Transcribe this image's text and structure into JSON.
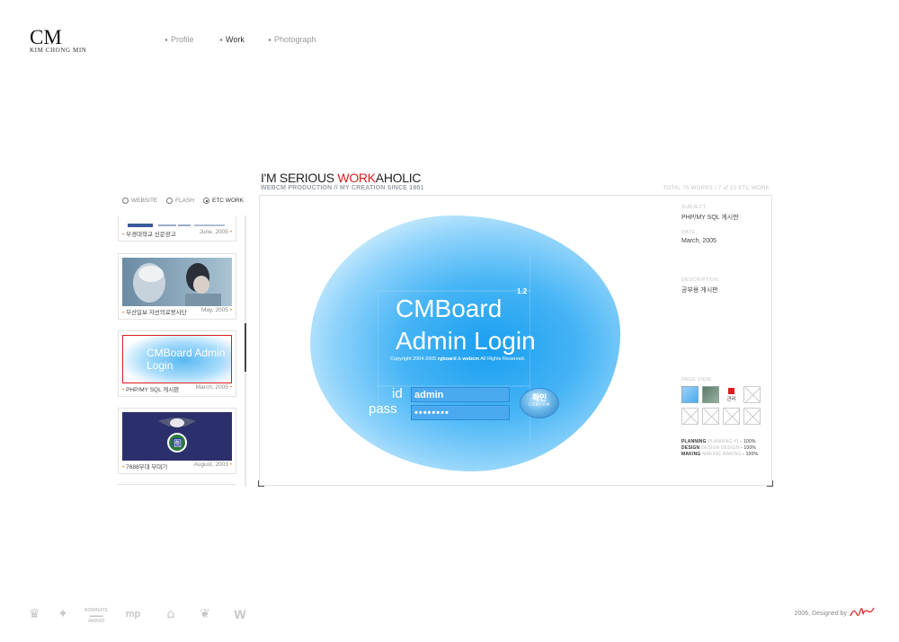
{
  "logo": {
    "mark": "CM",
    "name": "KIM CHONG MIN"
  },
  "nav": [
    {
      "label": "Profile",
      "active": false
    },
    {
      "label": "Work",
      "active": true
    },
    {
      "label": "Photograph",
      "active": false
    }
  ],
  "header": {
    "headline_prefix": "I'M SERIOUS ",
    "headline_highlight": "WORK",
    "headline_suffix": "AHOLIC",
    "subline": "WEBCM PRODUCTION // MY CREATION SINCE 1981",
    "total": "TOTAL 75 WORKS / 7 of 10 ETC WORK"
  },
  "filters": [
    {
      "label": "WEBSITE",
      "selected": false
    },
    {
      "label": "FLASH",
      "selected": false
    },
    {
      "label": "ETC WORK",
      "selected": true
    }
  ],
  "works": [
    {
      "title": "부경대학교 신문광고",
      "date": "June, 2005"
    },
    {
      "title": "부산일보 자선의료봉사단",
      "date": "May, 2005"
    },
    {
      "title": "PHP/MY SQL 게시판",
      "date": "March, 2005",
      "thumb_title": "CMBoard Admin Login"
    },
    {
      "title": "7688부대 부대기",
      "date": "August, 2003"
    }
  ],
  "preview": {
    "title_line1": "CMBoard",
    "title_line2": "Admin Login",
    "version": "1.2",
    "copyright_pre": "Copyright 2004-2005 ",
    "copyright_b1": "rgboard",
    "copyright_mid": " & ",
    "copyright_b2": "webcm",
    "copyright_post": " All Rights Reserved.",
    "id_label": "id",
    "pass_label": "pass",
    "id_value": "admin",
    "pass_value": "••••••••",
    "confirm_kr": "확인",
    "confirm_en": "CONFIRM"
  },
  "details": {
    "subject_label": "SUBJECT.",
    "subject": "PHP/MY SQL 게시판",
    "date_label": "DATE.",
    "date": "March, 2005",
    "description_label": "DESCRIPTION.",
    "description": "공부용 게시판",
    "pageview_label": "PAGE VIEW.",
    "pageview_admin": "관리"
  },
  "credits": [
    {
      "role": "PLANNING",
      "detail": "PLANNING #1",
      "value": "- 100%"
    },
    {
      "role": "DESIGN",
      "detail": "DESIGN DESIGN",
      "value": "- 100%"
    },
    {
      "role": "MAKING",
      "detail": "MAKING MAKING",
      "value": "- 100%"
    }
  ],
  "footer": {
    "designed_by": "2006, Designed by",
    "awards": [
      "crown-award-icon",
      "star-award-icon",
      "nominate-award-icon",
      "mp-award-icon",
      "home-award-icon",
      "wings-award-icon",
      "w-award-icon"
    ]
  },
  "colors": {
    "accent": "#d81e1e",
    "preview_blue": "#1a9ef0",
    "field_blue": "#4aa9ef",
    "orange_bullet": "#e88a2e"
  }
}
